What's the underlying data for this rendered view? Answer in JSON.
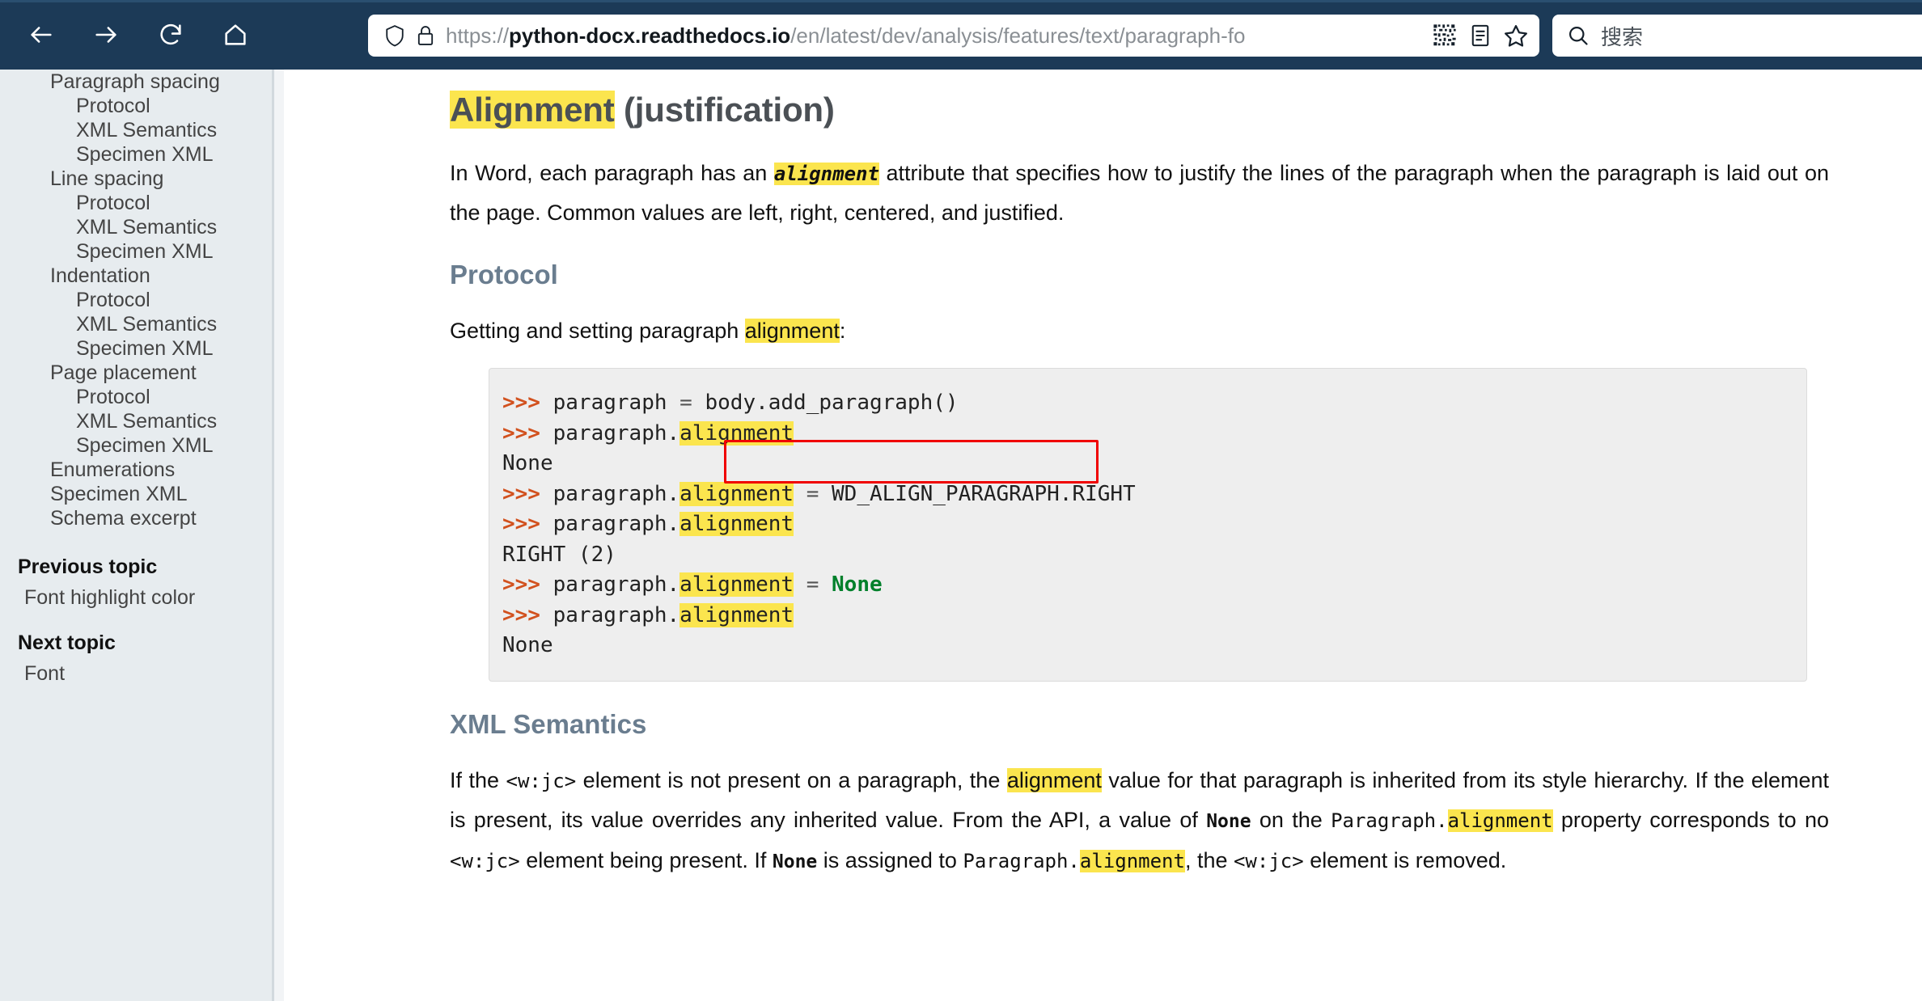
{
  "browser": {
    "nav": [
      {
        "name": "back-button",
        "icon": "arrow-left-icon"
      },
      {
        "name": "forward-button",
        "icon": "arrow-right-icon"
      },
      {
        "name": "reload-button",
        "icon": "reload-icon"
      },
      {
        "name": "home-button",
        "icon": "home-icon"
      }
    ],
    "url": {
      "scheme": "https://",
      "host": "python-docx.readthedocs.io",
      "path": "/en/latest/dev/analysis/features/text/paragraph-fo",
      "shield_icon": "shield-icon",
      "lock_icon": "lock-icon",
      "actions": [
        "qr-code-icon",
        "reader-view-icon",
        "bookmark-star-icon"
      ]
    },
    "search": {
      "placeholder": "搜索",
      "icon": "search-icon"
    }
  },
  "sidebar": {
    "toc": [
      {
        "label": "Paragraph spacing",
        "level": 2
      },
      {
        "label": "Protocol",
        "level": 3
      },
      {
        "label": "XML Semantics",
        "level": 3
      },
      {
        "label": "Specimen XML",
        "level": 3
      },
      {
        "label": "Line spacing",
        "level": 2
      },
      {
        "label": "Protocol",
        "level": 3
      },
      {
        "label": "XML Semantics",
        "level": 3
      },
      {
        "label": "Specimen XML",
        "level": 3
      },
      {
        "label": "Indentation",
        "level": 2
      },
      {
        "label": "Protocol",
        "level": 3
      },
      {
        "label": "XML Semantics",
        "level": 3
      },
      {
        "label": "Specimen XML",
        "level": 3
      },
      {
        "label": "Page placement",
        "level": 2
      },
      {
        "label": "Protocol",
        "level": 3
      },
      {
        "label": "XML Semantics",
        "level": 3
      },
      {
        "label": "Specimen XML",
        "level": 3
      },
      {
        "label": "Enumerations",
        "level": 2
      },
      {
        "label": "Specimen XML",
        "level": 2
      },
      {
        "label": "Schema excerpt",
        "level": 2
      }
    ],
    "previous_topic": {
      "heading": "Previous topic",
      "link": "Font highlight color"
    },
    "next_topic": {
      "heading": "Next topic",
      "link": "Font"
    }
  },
  "main": {
    "title_highlight": "Alignment",
    "title_rest": " (justification)",
    "intro": {
      "a": "In Word, each paragraph has an ",
      "code": "alignment",
      "b": " attribute that specifies how to justify the lines of the paragraph when the paragraph is laid out on the page. Common values are left, right, centered, and justified."
    },
    "protocol": {
      "heading": "Protocol",
      "lead_a": "Getting and setting paragraph ",
      "lead_hl": "alignment",
      "lead_b": ":",
      "code_lines": [
        {
          "prompt": ">>> ",
          "text": "paragraph = body.add_paragraph()"
        },
        {
          "prompt": ">>> ",
          "text": "paragraph.alignment"
        },
        {
          "prompt": "",
          "text": "None"
        },
        {
          "prompt": ">>> ",
          "text": "paragraph.alignment = WD_ALIGN_PARAGRAPH.RIGHT"
        },
        {
          "prompt": ">>> ",
          "text": "paragraph.alignment"
        },
        {
          "prompt": "",
          "text": "RIGHT (2)"
        },
        {
          "prompt": ">>> ",
          "text": "paragraph.alignment = None"
        },
        {
          "prompt": ">>> ",
          "text": "paragraph.alignment"
        },
        {
          "prompt": "",
          "text": "None"
        }
      ],
      "annotated_value": "WD_ALIGN_PARAGRAPH.RIGHT",
      "annotation_color": "#f00000"
    },
    "xml_semantics": {
      "heading": "XML Semantics",
      "p1_a": "If the ",
      "p1_code1": "<w:jc>",
      "p1_b": " element is not present on a paragraph, the ",
      "p1_hl": "alignment",
      "p1_c": " value for that paragraph is inherited from its style hierarchy. If the element is present, its value overrides any inherited value. From the API, a value of ",
      "p1_code2": "None",
      "p1_d": " on the ",
      "p1_code3": "Paragraph.",
      "p1_hl2": "alignment",
      "p1_e": " property corresponds to no ",
      "p1_code4": "<w:jc>",
      "p1_f": " element being present. If ",
      "p1_code5": "None",
      "p1_g": " is assigned to ",
      "p1_code6": "Paragraph.",
      "p1_hl3": "alignment",
      "p1_h": ", the ",
      "p1_code7": "<w:jc>",
      "p1_i": " element is removed."
    }
  },
  "colors": {
    "chrome": "#1c3a57",
    "sidebar_bg": "#e7ecef",
    "highlight_yellow": "#fbe54e",
    "heading_blue": "#6a7d8f",
    "prompt_orange": "#d2511e",
    "none_green": "#00802b",
    "annotation_red": "#f00000"
  }
}
